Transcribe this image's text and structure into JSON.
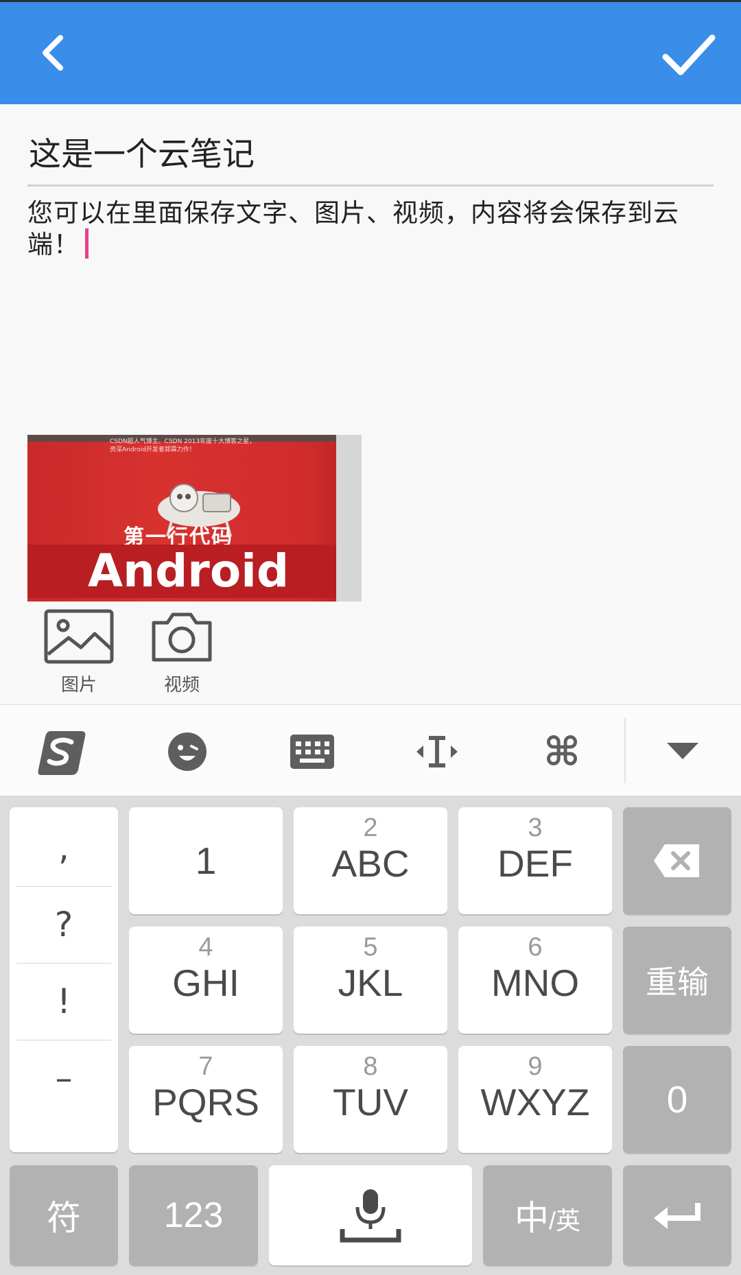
{
  "appbar": {
    "back_icon": "chevron-left-icon",
    "done_icon": "check-icon",
    "bg_color": "#3a8de8"
  },
  "note": {
    "title": "这是一个云笔记",
    "body": "您可以在里面保存文字、图片、视频，内容将会保存到云端！"
  },
  "photo": {
    "blurb_line1": "CSDN超人气博主、CSDN 2013年度十大博客之星，",
    "blurb_line2": "资深Android开发者郭霖力作！",
    "cn_title": "第一行代码",
    "en_title": "Android"
  },
  "attachments": [
    {
      "label": "图片",
      "icon": "image-icon"
    },
    {
      "label": "视频",
      "icon": "camera-icon"
    }
  ],
  "keyboard": {
    "toolbar": [
      "sogou-logo-icon",
      "emoji-icon",
      "keyboard-icon",
      "cursor-icon",
      "command-icon",
      "collapse-icon"
    ],
    "punctuation": [
      ",",
      "?",
      "!",
      "–"
    ],
    "keys": [
      {
        "num": "",
        "label": "1"
      },
      {
        "num": "2",
        "label": "ABC"
      },
      {
        "num": "3",
        "label": "DEF"
      },
      {
        "num": "4",
        "label": "GHI"
      },
      {
        "num": "5",
        "label": "JKL"
      },
      {
        "num": "6",
        "label": "MNO"
      },
      {
        "num": "7",
        "label": "PQRS"
      },
      {
        "num": "8",
        "label": "TUV"
      },
      {
        "num": "9",
        "label": "WXYZ"
      }
    ],
    "side": {
      "delete_icon": "backspace-icon",
      "reset": "重输",
      "zero": "0"
    },
    "bottom": {
      "symbols": "符",
      "numeric": "123",
      "mic_icon": "microphone-icon",
      "lang_main": "中",
      "lang_sub": "/英",
      "enter_icon": "enter-icon"
    }
  }
}
